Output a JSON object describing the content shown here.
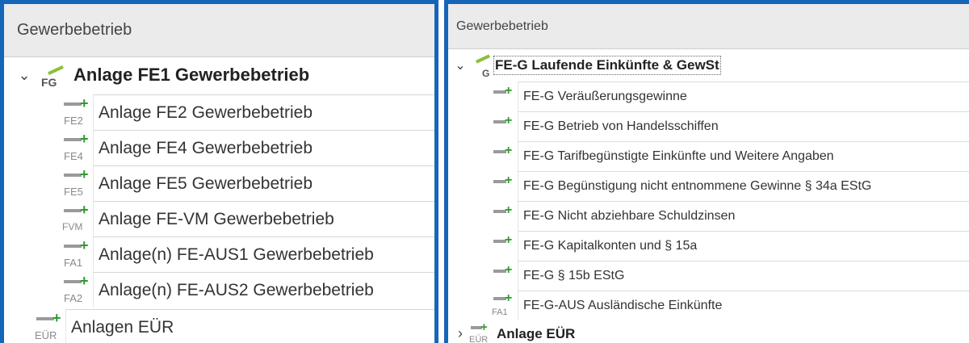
{
  "left_panel": {
    "header": "Gewerbebetrieb",
    "root": {
      "icon_code": "FG",
      "label": "Anlage FE1 Gewerbebetrieb"
    },
    "children": [
      {
        "icon_code": "FE2",
        "label": "Anlage FE2 Gewerbebetrieb"
      },
      {
        "icon_code": "FE4",
        "label": "Anlage FE4 Gewerbebetrieb"
      },
      {
        "icon_code": "FE5",
        "label": "Anlage FE5 Gewerbebetrieb"
      },
      {
        "icon_code": "FVM",
        "label": "Anlage FE-VM Gewerbebetrieb"
      },
      {
        "icon_code": "FA1",
        "label": "Anlage(n) FE-AUS1 Gewerbebetrieb"
      },
      {
        "icon_code": "FA2",
        "label": "Anlage(n) FE-AUS2 Gewerbebetrieb"
      }
    ],
    "sibling": {
      "icon_code": "EÜR",
      "label": "Anlagen EÜR"
    }
  },
  "right_panel": {
    "header": "Gewerbebetrieb",
    "root": {
      "icon_code": "G",
      "label": "FE-G Laufende Einkünfte & GewSt"
    },
    "children": [
      {
        "icon_code": "",
        "label": "FE-G Veräußerungsgewinne"
      },
      {
        "icon_code": "",
        "label": "FE-G Betrieb von Handelsschiffen"
      },
      {
        "icon_code": "",
        "label": "FE-G Tarifbegünstigte Einkünfte und Weitere Angaben"
      },
      {
        "icon_code": "",
        "label": "FE-G Begünstigung nicht entnommene Gewinne § 34a EStG"
      },
      {
        "icon_code": "",
        "label": "FE-G Nicht abziehbare Schuldzinsen"
      },
      {
        "icon_code": "",
        "label": "FE-G Kapitalkonten und § 15a"
      },
      {
        "icon_code": "",
        "label": "FE-G § 15b EStG"
      },
      {
        "icon_code": "FA1",
        "label": "FE-G-AUS Ausländische Einkünfte"
      }
    ],
    "sibling": {
      "icon_code": "EÜR",
      "label": "Anlage EÜR"
    }
  },
  "colors": {
    "border": "#1565b8",
    "plus": "#2e9a2e",
    "header_bg": "#ebebeb",
    "accent_slash": "#8cbf3a"
  },
  "icons": {
    "expanded": "chevron-down-icon",
    "collapsed": "chevron-right-icon",
    "form": "form-add-icon"
  }
}
